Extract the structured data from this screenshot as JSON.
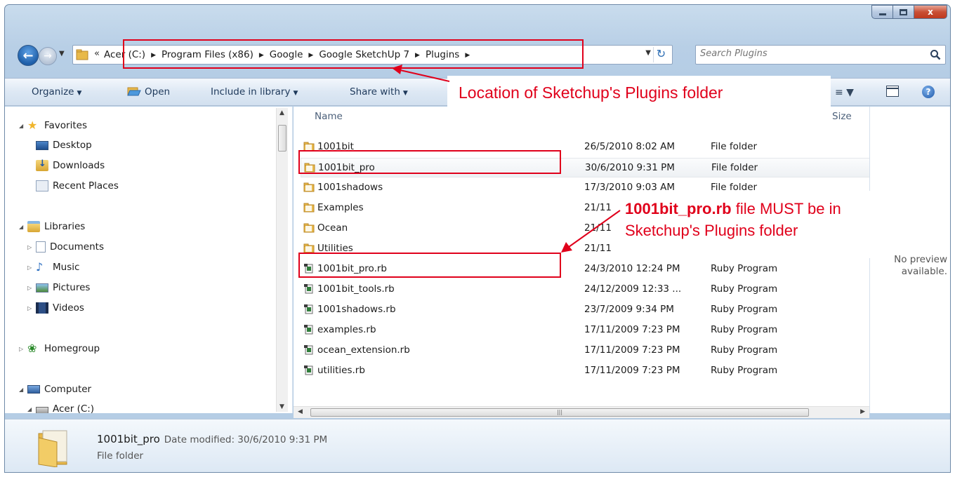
{
  "window": {
    "caption_buttons": [
      "minimize",
      "maximize",
      "close"
    ],
    "close_label": "x"
  },
  "address": {
    "crumbs": [
      "Acer (C:)",
      "Program Files (x86)",
      "Google",
      "Google SketchUp 7",
      "Plugins"
    ],
    "overflow_chevron": "«",
    "search_placeholder": "Search Plugins"
  },
  "toolbar": {
    "organize": "Organize",
    "open": "Open",
    "include_in_library": "Include in library",
    "share_with": "Share with",
    "help": "?"
  },
  "navpane": {
    "favorites": "Favorites",
    "desktop": "Desktop",
    "downloads": "Downloads",
    "recent_places": "Recent Places",
    "libraries": "Libraries",
    "documents": "Documents",
    "music": "Music",
    "pictures": "Pictures",
    "videos": "Videos",
    "homegroup": "Homegroup",
    "computer": "Computer",
    "drive": "Acer (C:)"
  },
  "filelist": {
    "columns": {
      "name": "Name",
      "size": "Size"
    },
    "rows": [
      {
        "name": "1001bit",
        "date": "26/5/2010 8:02 AM",
        "type": "File folder",
        "kind": "folder"
      },
      {
        "name": "1001bit_pro",
        "date": "30/6/2010 9:31 PM",
        "type": "File folder",
        "kind": "folder",
        "selected": true
      },
      {
        "name": "1001shadows",
        "date": "17/3/2010 9:03 AM",
        "type": "File folder",
        "kind": "folder"
      },
      {
        "name": "Examples",
        "date": "21/11",
        "type": "",
        "kind": "folder"
      },
      {
        "name": "Ocean",
        "date": "21/11",
        "type": "",
        "kind": "folder"
      },
      {
        "name": "Utilities",
        "date": "21/11",
        "type": "",
        "kind": "folder"
      },
      {
        "name": "1001bit_pro.rb",
        "date": "24/3/2010 12:24 PM",
        "type": "Ruby Program",
        "kind": "ruby"
      },
      {
        "name": "1001bit_tools.rb",
        "date": "24/12/2009 12:33 ...",
        "type": "Ruby Program",
        "kind": "ruby"
      },
      {
        "name": "1001shadows.rb",
        "date": "23/7/2009 9:34 PM",
        "type": "Ruby Program",
        "kind": "ruby"
      },
      {
        "name": "examples.rb",
        "date": "17/11/2009 7:23 PM",
        "type": "Ruby Program",
        "kind": "ruby"
      },
      {
        "name": "ocean_extension.rb",
        "date": "17/11/2009 7:23 PM",
        "type": "Ruby Program",
        "kind": "ruby"
      },
      {
        "name": "utilities.rb",
        "date": "17/11/2009 7:23 PM",
        "type": "Ruby Program",
        "kind": "ruby"
      }
    ]
  },
  "preview": {
    "line1": "No preview",
    "line2": "available."
  },
  "details": {
    "name": "1001bit_pro",
    "meta": "Date modified: 30/6/2010 9:31 PM",
    "type": "File folder"
  },
  "annotations": {
    "callout1": "Location of Sketchup's Plugins folder",
    "callout2_bold": "1001bit_pro.rb",
    "callout2_rest": " file MUST be in",
    "callout2_line2": "Sketchup's Plugins folder",
    "color": "#e0001b"
  },
  "colors": {
    "frame": "#b8cfe6",
    "toolbar_text": "#1e395b",
    "column_header": "#4c607a"
  }
}
